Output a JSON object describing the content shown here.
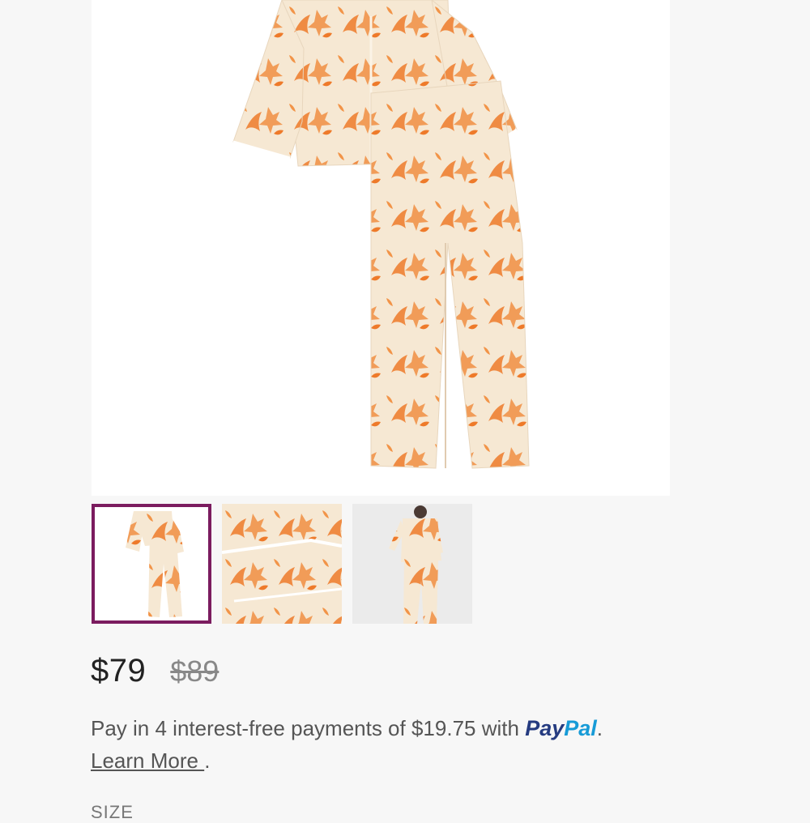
{
  "product": {
    "main_image_alt": "",
    "thumbnails": [
      {
        "selected": true
      },
      {
        "selected": false
      },
      {
        "selected": false
      }
    ],
    "selected_border_color": "#7b1c5f",
    "print_colors": {
      "base": "#f6e8d3",
      "pattern": "#ee7a2a"
    }
  },
  "pricing": {
    "current": "$79",
    "original": "$89"
  },
  "paypal": {
    "text_before": "Pay in 4 interest-free payments of $19.75 with ",
    "logo_part1": "Pay",
    "logo_part2": "Pal",
    "text_after": ".",
    "learn_more": "Learn More ",
    "learn_more_after": "."
  },
  "size": {
    "label": "SIZE"
  }
}
